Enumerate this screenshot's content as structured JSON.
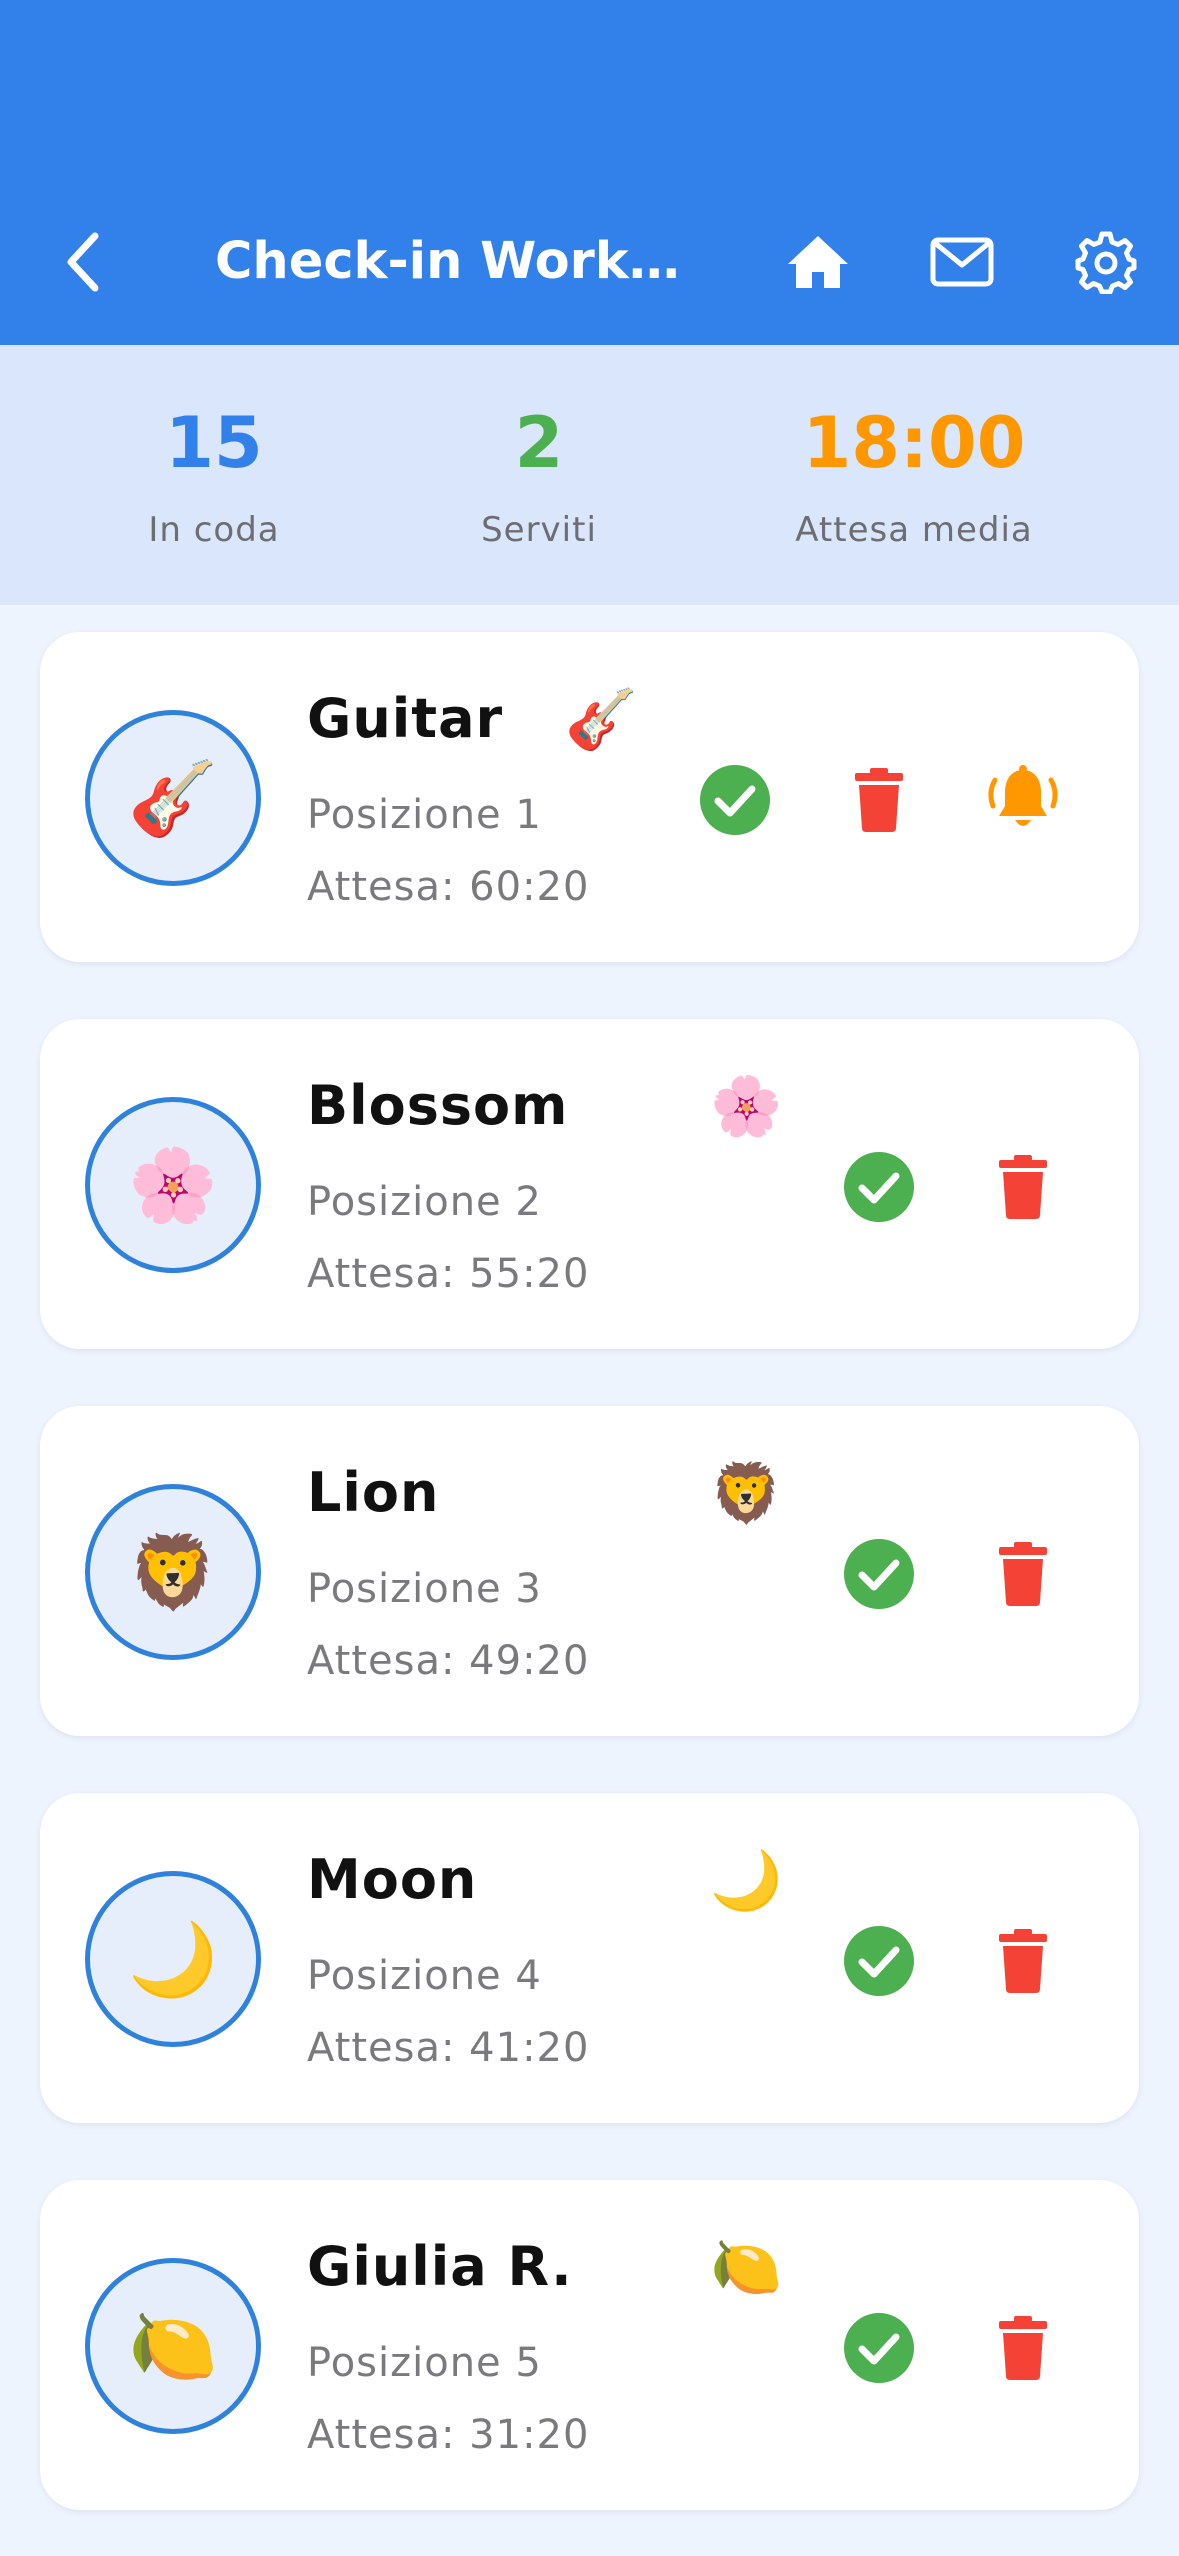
{
  "header": {
    "title": "Check-in Worksh…",
    "icons": [
      "chevron-left-icon",
      "home-icon",
      "mail-icon",
      "gear-icon"
    ],
    "background": "#3281ea"
  },
  "stats": {
    "queue": {
      "value": "15",
      "label": "In coda",
      "color": "#3281ea"
    },
    "served": {
      "value": "2",
      "label": "Serviti",
      "color": "#4caf50"
    },
    "wait": {
      "value": "18:00",
      "label": "Attesa media",
      "color": "#ff9800"
    }
  },
  "colors": {
    "check": "#4caf50",
    "trash": "#f44336",
    "bell": "#ff9800",
    "avatar_border": "#2f82dc"
  },
  "queue": [
    {
      "name": "Guitar",
      "emoji": "🎸",
      "position": "Posizione 1",
      "wait": "Attesa: 60:20",
      "has_notify": true
    },
    {
      "name": "Blossom",
      "emoji": "🌸",
      "position": "Posizione 2",
      "wait": "Attesa: 55:20",
      "has_notify": false
    },
    {
      "name": "Lion",
      "emoji": "🦁",
      "position": "Posizione 3",
      "wait": "Attesa: 49:20",
      "has_notify": false
    },
    {
      "name": "Moon",
      "emoji": "🌙",
      "position": "Posizione 4",
      "wait": "Attesa: 41:20",
      "has_notify": false
    },
    {
      "name": "Giulia R.",
      "emoji": "🍋",
      "position": "Posizione 5",
      "wait": "Attesa: 31:20",
      "has_notify": false
    }
  ]
}
